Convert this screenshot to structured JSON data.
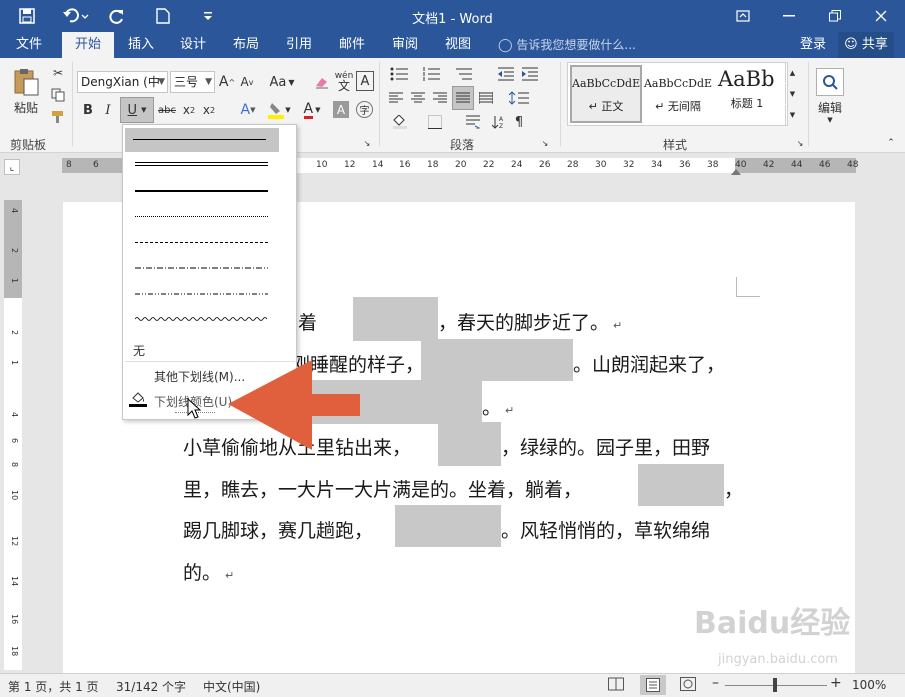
{
  "title": "文档1 - Word",
  "tabs": [
    "文件",
    "开始",
    "插入",
    "设计",
    "布局",
    "引用",
    "邮件",
    "审阅",
    "视图"
  ],
  "tell_me": "告诉我您想要做什么...",
  "login": "登录",
  "share": "共享",
  "clipboard": {
    "paste_label": "粘贴",
    "group_label": "剪贴板"
  },
  "font": {
    "name": "DengXian (中",
    "size": "三号",
    "change_case": "Aa"
  },
  "paragraph": {
    "group_label": "段落"
  },
  "styles": {
    "group_label": "样式",
    "items": [
      {
        "preview": "AaBbCcDdE",
        "label": "↵ 正文"
      },
      {
        "preview": "AaBbCcDdE",
        "label": "↵ 无间隔"
      },
      {
        "preview": "AaBb",
        "label": "标题 1"
      }
    ]
  },
  "editing": {
    "label": "编辑"
  },
  "ruler_h": [
    "8",
    "6",
    "10",
    "12",
    "14",
    "16",
    "18",
    "20",
    "22",
    "24",
    "26",
    "28",
    "30",
    "32",
    "34",
    "36",
    "38",
    "40",
    "42",
    "44",
    "46",
    "48"
  ],
  "ruler_v": [
    "4",
    "2",
    "1",
    "2",
    "1",
    "4",
    "6",
    "8",
    "10",
    "12",
    "14",
    "16",
    "18"
  ],
  "underline_menu": {
    "none": "无",
    "more": "其他下划线(M)...",
    "color": "下划线颜色(U)"
  },
  "doc_lines": [
    {
      "before": "盼望着",
      "after": "，春天的脚步近了。",
      "mark": "↵"
    },
    {
      "before": "切都像刚睡醒的样子，",
      "after": "。山朗润起来了，",
      "mark": ""
    },
    {
      "before": "",
      "after": "。",
      "mark": "↵"
    },
    {
      "before": "小草偷偷地从土里钻出来，",
      "after": "，绿绿的。园子里，田野",
      "mark": ""
    },
    {
      "before": "里，瞧去，一大片一大片满是的。坐着，躺着，",
      "after": "，",
      "mark": ""
    },
    {
      "before": "踢几脚球，赛几趟跑，",
      "after": "。风轻悄悄的，草软绵绵",
      "mark": ""
    },
    {
      "before": "的。",
      "after": "",
      "mark": "↵"
    }
  ],
  "status": {
    "page": "第 1 页，共 1 页",
    "words": "31/142 个字",
    "lang": "中文(中国)",
    "zoom": "100%"
  },
  "watermark": {
    "logo": "Baidu经验",
    "url": "jingyan.baidu.com"
  },
  "colors": {
    "accent": "#2b579a",
    "arrow": "#e0603e"
  }
}
